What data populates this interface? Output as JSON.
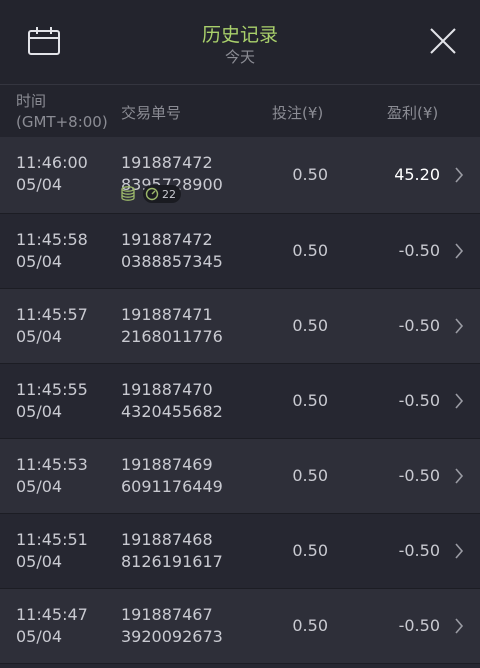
{
  "header": {
    "title": "历史记录",
    "subtitle": "今天",
    "left_icon": "calendar-icon",
    "right_icon": "close-icon"
  },
  "columns": {
    "time_line1": "时间",
    "time_line2": "(GMT+8:00)",
    "order": "交易单号",
    "bet": "投注(¥)",
    "profit": "盈利(¥)"
  },
  "rows": [
    {
      "time": "11:46:00",
      "date": "05/04",
      "order1": "191887472",
      "order2": "8395728900",
      "bet": "0.50",
      "profit": "45.20",
      "win": true,
      "combo_count": "22"
    },
    {
      "time": "11:45:58",
      "date": "05/04",
      "order1": "191887472",
      "order2": "0388857345",
      "bet": "0.50",
      "profit": "-0.50",
      "win": false
    },
    {
      "time": "11:45:57",
      "date": "05/04",
      "order1": "191887471",
      "order2": "2168011776",
      "bet": "0.50",
      "profit": "-0.50",
      "win": false
    },
    {
      "time": "11:45:55",
      "date": "05/04",
      "order1": "191887470",
      "order2": "4320455682",
      "bet": "0.50",
      "profit": "-0.50",
      "win": false
    },
    {
      "time": "11:45:53",
      "date": "05/04",
      "order1": "191887469",
      "order2": "6091176449",
      "bet": "0.50",
      "profit": "-0.50",
      "win": false
    },
    {
      "time": "11:45:51",
      "date": "05/04",
      "order1": "191887468",
      "order2": "8126191617",
      "bet": "0.50",
      "profit": "-0.50",
      "win": false
    },
    {
      "time": "11:45:47",
      "date": "05/04",
      "order1": "191887467",
      "order2": "3920092673",
      "bet": "0.50",
      "profit": "-0.50",
      "win": false
    }
  ],
  "colors": {
    "title": "#a9d06b",
    "background": "#262731",
    "row_alt": "#2e2f39",
    "coin_icon": "#9bb86a"
  }
}
